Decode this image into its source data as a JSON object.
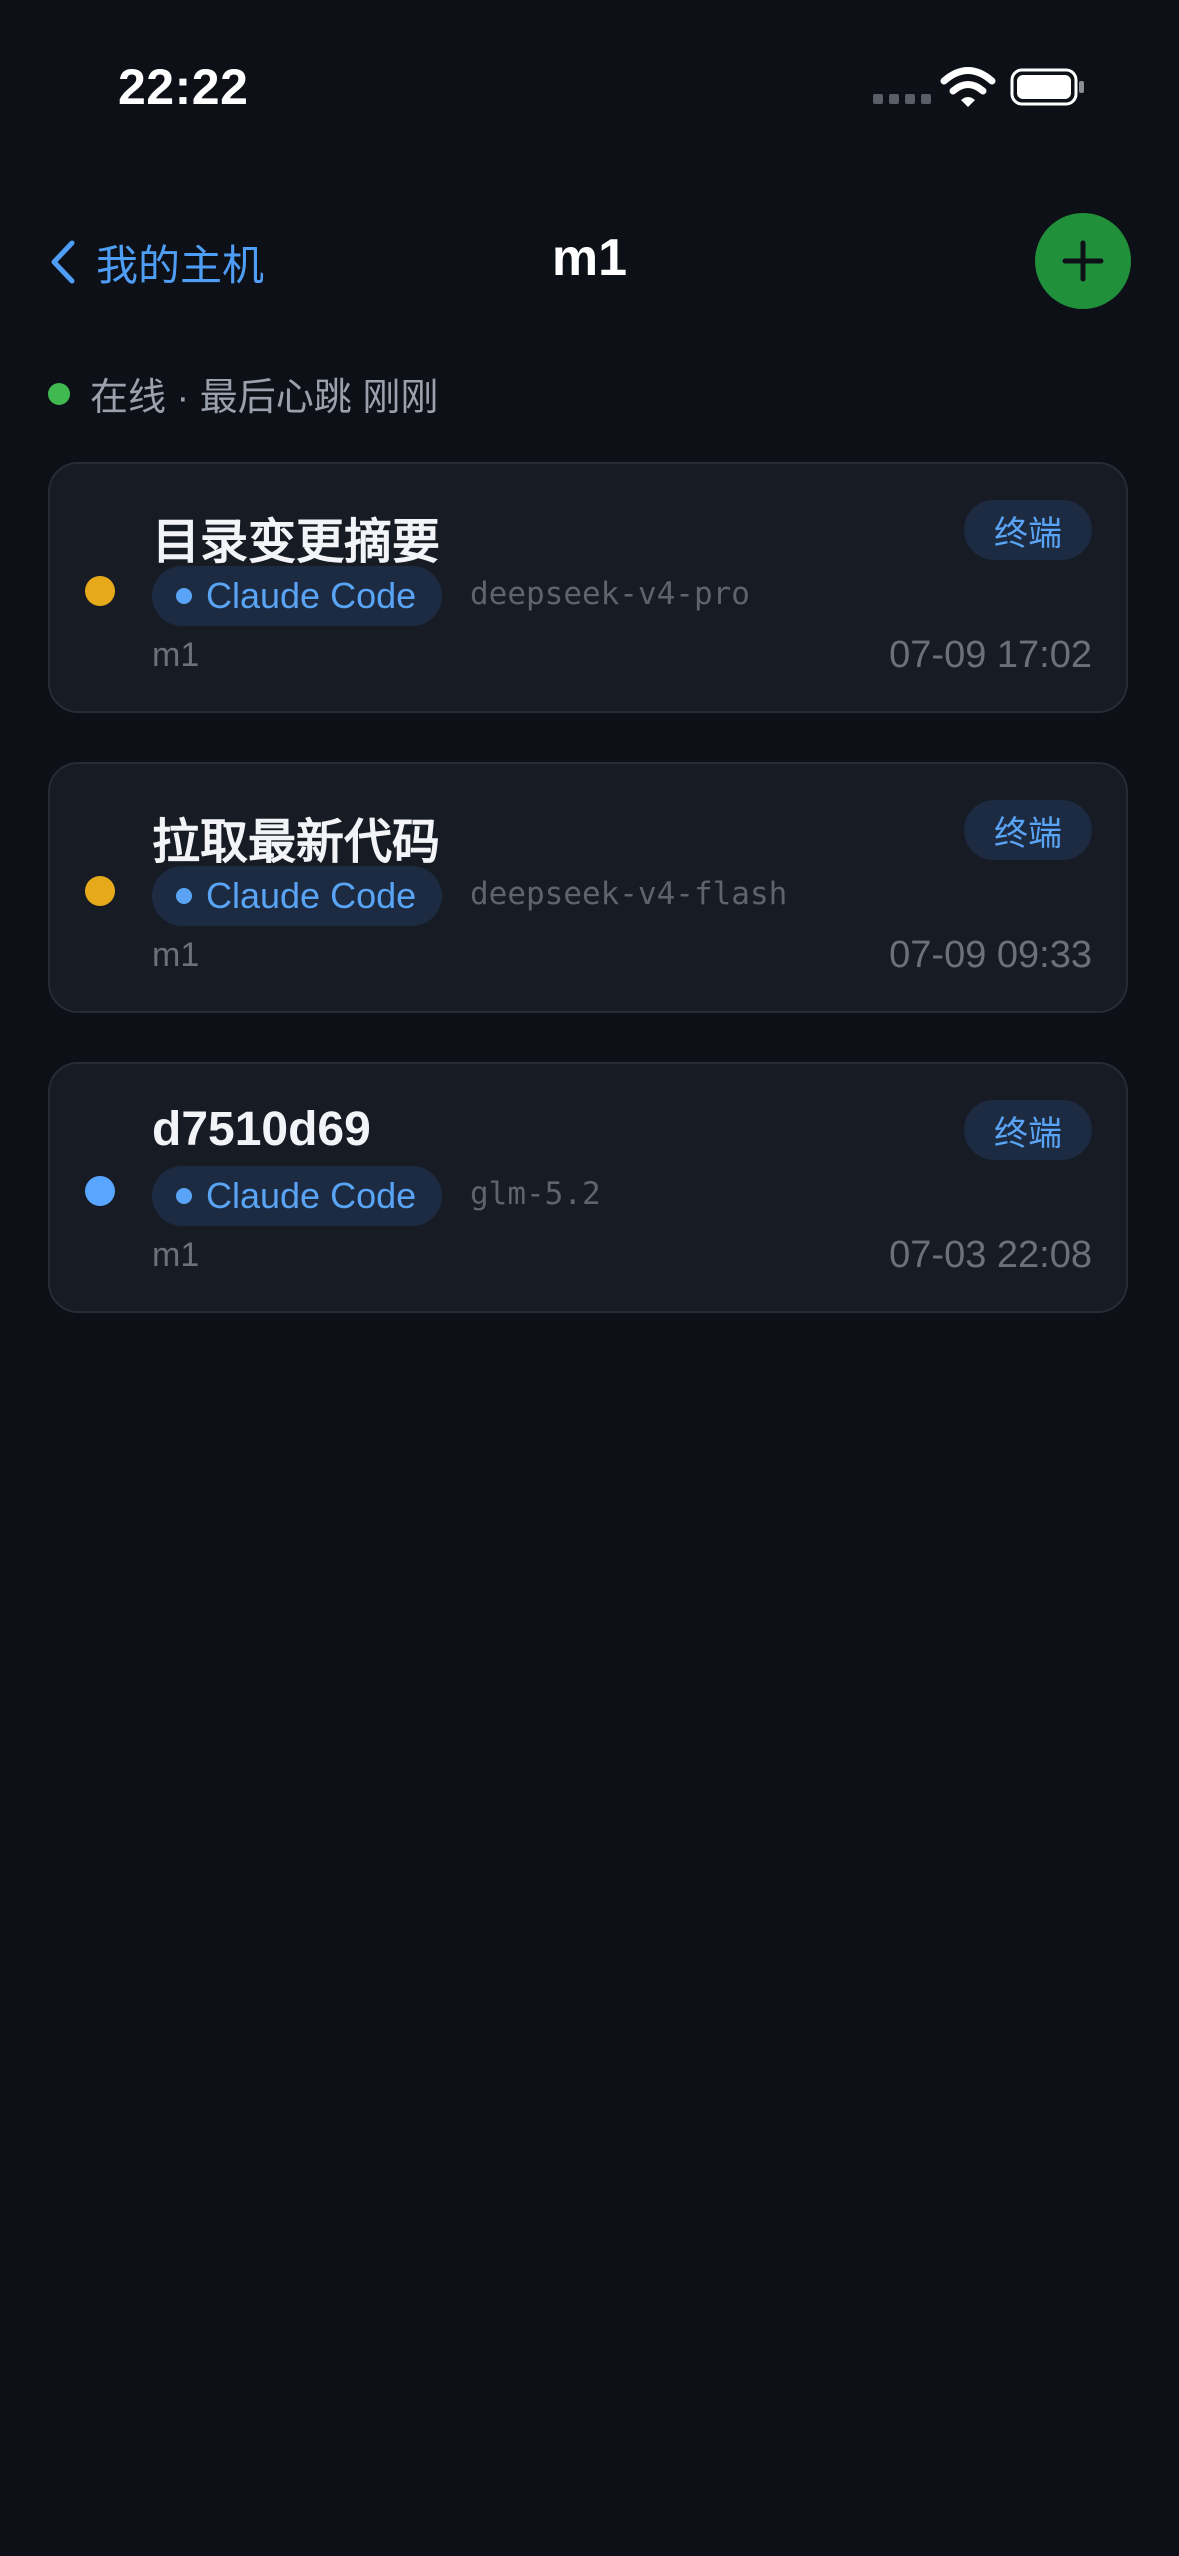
{
  "status_bar": {
    "time": "22:22"
  },
  "nav": {
    "back_label": "我的主机",
    "title": "m1",
    "add_icon": "plus-icon"
  },
  "host": {
    "status_text": "在线 · 最后心跳 刚刚",
    "status_color": "#3fb950"
  },
  "sessions": [
    {
      "title": "目录变更摘要",
      "state_color": "#e6a91a",
      "agent": "Claude Code",
      "model": "deepseek-v4-pro",
      "host": "m1",
      "time": "07-09 17:02",
      "action_label": "终端"
    },
    {
      "title": "拉取最新代码",
      "state_color": "#e6a91a",
      "agent": "Claude Code",
      "model": "deepseek-v4-flash",
      "host": "m1",
      "time": "07-09 09:33",
      "action_label": "终端"
    },
    {
      "title": "d7510d69",
      "state_color": "#58a6ff",
      "agent": "Claude Code",
      "model": "glm-5.2",
      "host": "m1",
      "time": "07-03 22:08",
      "action_label": "终端"
    }
  ],
  "colors": {
    "accent": "#4f9ef5",
    "add_button": "#21903a",
    "background": "#0d1017",
    "card": "#171b23"
  }
}
